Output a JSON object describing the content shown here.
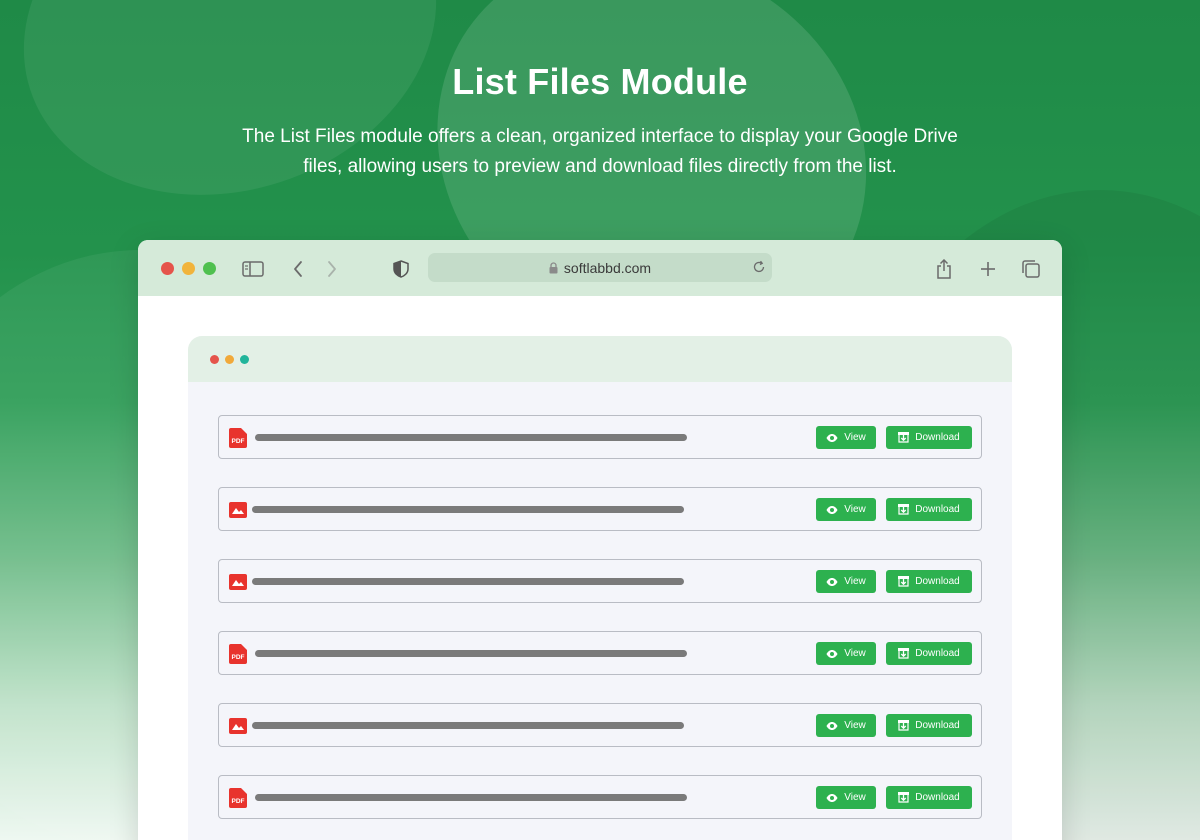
{
  "hero": {
    "title": "List Files Module",
    "description": "The List Files module offers a clean, organized interface to display your Google Drive files, allowing users to preview and download files directly from the list."
  },
  "browser": {
    "url": "softlabbd.com",
    "window_dots": [
      "#e5544b",
      "#f1b43b",
      "#4fc04f"
    ],
    "toolbar_icons": [
      "sidebar-icon",
      "back-icon",
      "forward-icon",
      "shield-icon",
      "share-icon",
      "new-tab-icon",
      "tabs-icon"
    ]
  },
  "panel": {
    "dots": [
      "#e5544b",
      "#f1a93a",
      "#21b59b"
    ]
  },
  "files": [
    {
      "type": "pdf",
      "icon_label": "PDF",
      "view_label": "View",
      "download_label": "Download"
    },
    {
      "type": "image",
      "icon_label": "",
      "view_label": "View",
      "download_label": "Download"
    },
    {
      "type": "image",
      "icon_label": "",
      "view_label": "View",
      "download_label": "Download"
    },
    {
      "type": "pdf",
      "icon_label": "PDF",
      "view_label": "View",
      "download_label": "Download"
    },
    {
      "type": "image",
      "icon_label": "",
      "view_label": "View",
      "download_label": "Download"
    },
    {
      "type": "pdf",
      "icon_label": "PDF",
      "view_label": "View",
      "download_label": "Download"
    }
  ],
  "colors": {
    "accent_green": "#2db14f",
    "file_icon_red": "#e8332d"
  }
}
